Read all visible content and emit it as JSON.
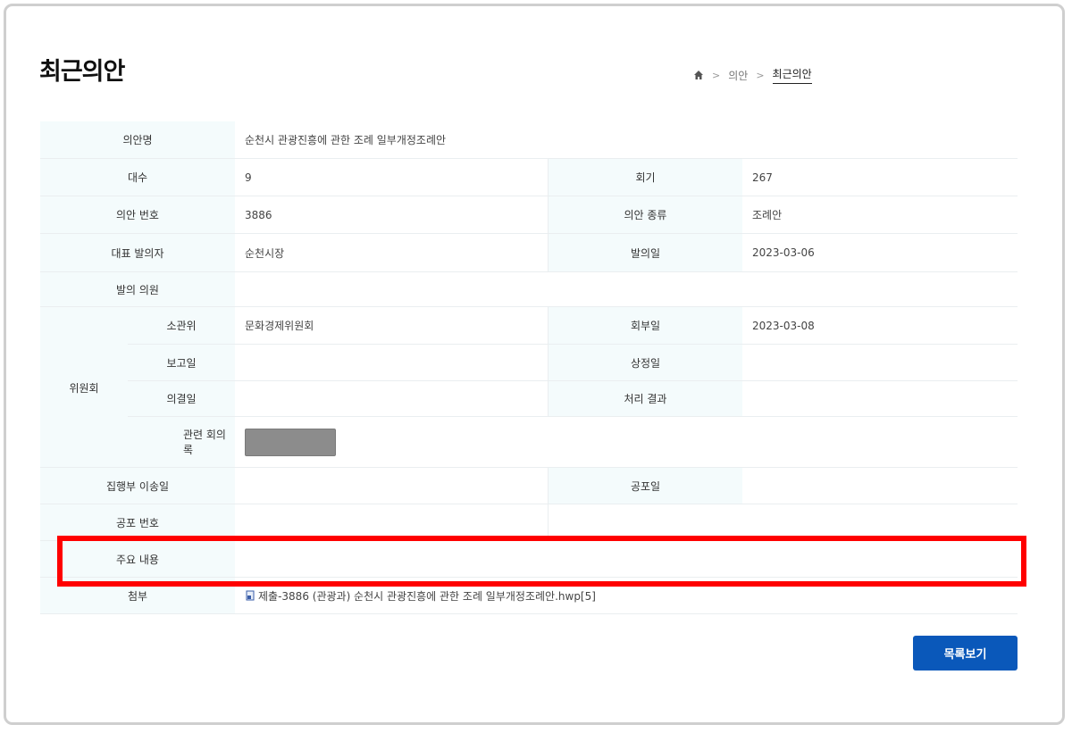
{
  "page_title": "최근의안",
  "breadcrumb": {
    "home_icon": "home-icon",
    "items": [
      "의안",
      "최근의안"
    ]
  },
  "bill": {
    "name_label": "의안명",
    "name_value": "순천시 관광진흥에 관한 조례 일부개정조례안",
    "session_label": "대수",
    "session_value": "9",
    "meeting_label": "회기",
    "meeting_value": "267",
    "number_label": "의안 번호",
    "number_value": "3886",
    "type_label": "의안 종류",
    "type_value": "조례안",
    "proposer_label": "대표 발의자",
    "proposer_value": "순천시장",
    "proposal_date_label": "발의일",
    "proposal_date_value": "2023-03-06",
    "members_label": "발의 의원",
    "members_value": ""
  },
  "committee": {
    "label": "위원회",
    "name_label": "소관위",
    "name_value": "문화경제위원회",
    "referral_label": "회부일",
    "referral_value": "2023-03-08",
    "report_label": "보고일",
    "report_value": "",
    "submission_label": "상정일",
    "submission_value": "",
    "resolution_label": "의결일",
    "resolution_value": "",
    "result_label": "처리 결과",
    "result_value": "",
    "minutes_label": "관련 회의록"
  },
  "execution": {
    "transfer_label": "집행부 이송일",
    "transfer_value": "",
    "promulgation_label": "공포일",
    "promulgation_value": "",
    "promulgation_no_label": "공포 번호",
    "promulgation_no_value": "",
    "summary_label": "주요 내용",
    "summary_value": "",
    "attachment_label": "첨부",
    "attachment_value": "제출-3886 (관광과) 순천시 관광진흥에 관한 조례 일부개정조례안.hwp[5]",
    "attachment_icon": "hwp-file-icon"
  },
  "buttons": {
    "list_label": "목록보기"
  },
  "colors": {
    "accent": "#0a58ba",
    "header_bg": "#f4fbfc",
    "highlight": "#ff0000"
  }
}
